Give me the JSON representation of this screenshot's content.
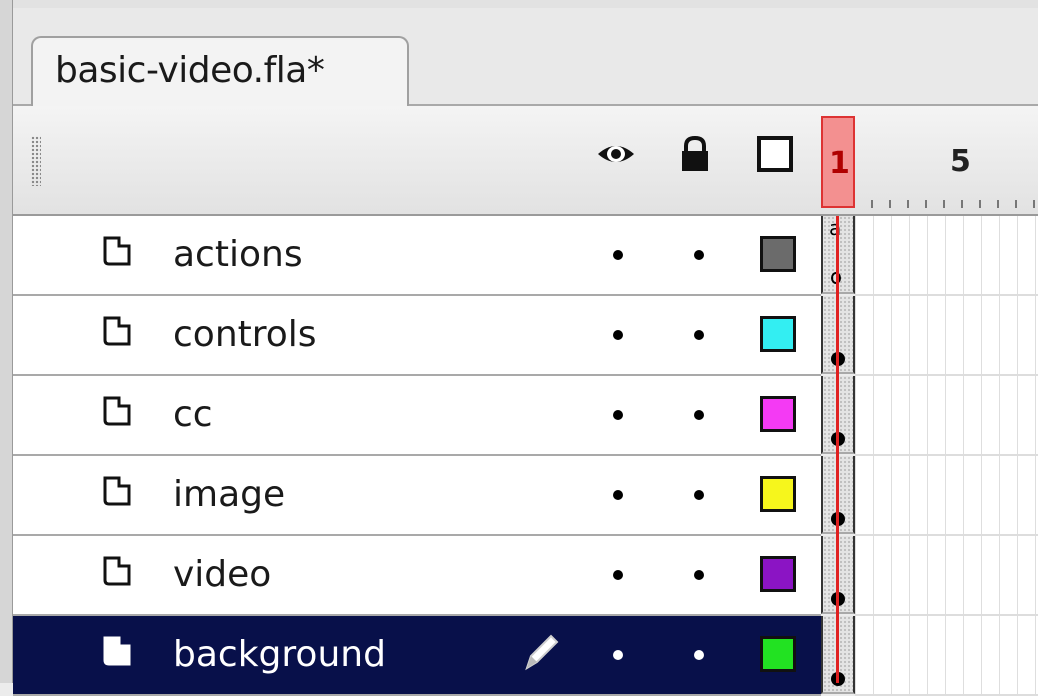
{
  "document": {
    "tab_label": "basic-video.fla*"
  },
  "header": {
    "icons": [
      "eye-icon",
      "lock-icon",
      "outline-icon"
    ],
    "playhead_frame": "1",
    "frame_marker": "5"
  },
  "layers": [
    {
      "name": "actions",
      "color": "#6b6b6b",
      "selected": false,
      "keyframe": "action"
    },
    {
      "name": "controls",
      "color": "#33eef2",
      "selected": false,
      "keyframe": "filled"
    },
    {
      "name": "cc",
      "color": "#f43af4",
      "selected": false,
      "keyframe": "filled"
    },
    {
      "name": "image",
      "color": "#f6f61c",
      "selected": false,
      "keyframe": "filled"
    },
    {
      "name": "video",
      "color": "#8b14c4",
      "selected": false,
      "keyframe": "filled"
    },
    {
      "name": "background",
      "color": "#22e222",
      "selected": true,
      "keyframe": "filled"
    }
  ],
  "action_keyframe_glyph": "a"
}
